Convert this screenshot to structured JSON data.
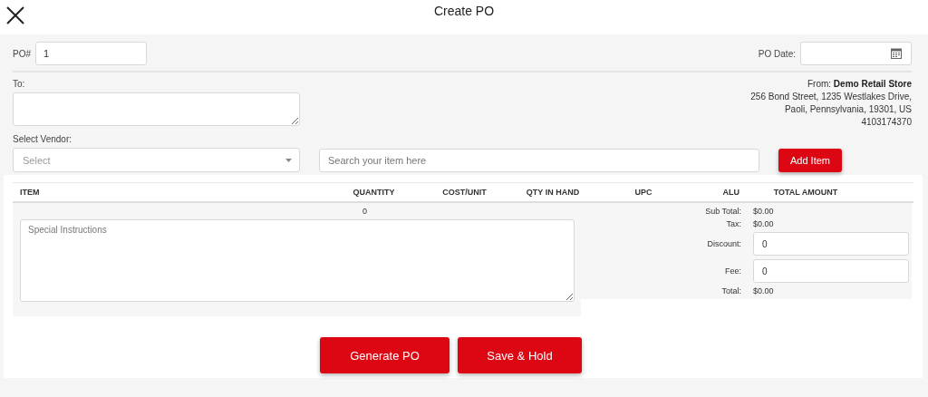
{
  "title": "Create PO",
  "po_number": {
    "label": "PO#",
    "value": "1"
  },
  "po_date": {
    "label": "PO Date:"
  },
  "to": {
    "label": "To:"
  },
  "from_line": "From: **Demo Retail Store**",
  "address_lines": [
    "256 Bond Street, 1235 Westlakes Drive,",
    "Paoli, Pennsylvania, 19301, US",
    "4103174370"
  ],
  "vendor": {
    "label": "Select Vendor:",
    "placeholder": "Select"
  },
  "search": {
    "placeholder": "Search your item here"
  },
  "add_button": "Add Item",
  "table": {
    "columns": [
      "ITEM",
      "QUANTITY",
      "COST/UNIT",
      "QTY IN HAND",
      "UPC",
      "ALU",
      "TOTAL AMOUNT"
    ],
    "quantity_total": "0"
  },
  "special_instructions": {
    "placeholder": "Special Instructions"
  },
  "summary": [
    {
      "kind": "text",
      "label": "Sub Total:",
      "value": "$0.00"
    },
    {
      "kind": "text",
      "label": "Tax:",
      "value": "$0.00"
    },
    {
      "kind": "input",
      "label": "Discount:",
      "value": "0"
    },
    {
      "kind": "input",
      "label": "Fee:",
      "value": "0"
    },
    {
      "kind": "text",
      "label": "Total:",
      "value": "$0.00"
    }
  ],
  "buttons": [
    "Generate PO",
    "Save & Hold"
  ]
}
